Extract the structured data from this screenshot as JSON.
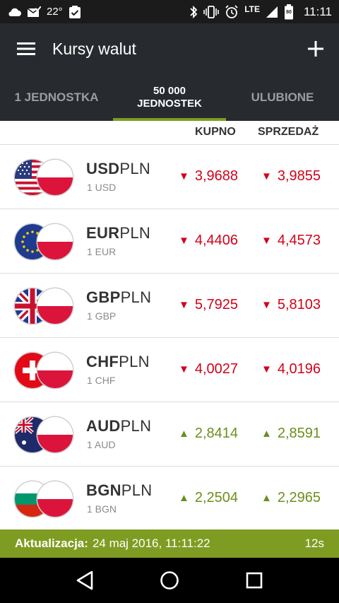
{
  "status_bar": {
    "temperature": "22°",
    "network": "LTE",
    "battery": "80",
    "time": "11:11",
    "icons": [
      "cloud-icon",
      "mail-check-icon",
      "clipboard-check-icon",
      "bluetooth-icon",
      "vibrate-icon",
      "alarm-icon",
      "signal-icon",
      "battery-icon"
    ]
  },
  "app_bar": {
    "title": "Kursy walut",
    "menu_icon": "menu-icon",
    "add_icon": "plus-icon"
  },
  "tabs": [
    {
      "label": "1 JEDNOSTKA",
      "active": false
    },
    {
      "label_line1": "50 000",
      "label_line2": "JEDNOSTEK",
      "active": true
    },
    {
      "label": "ULUBIONE",
      "active": false
    }
  ],
  "columns": {
    "buy": "KUPNO",
    "sell": "SPRZEDAŻ"
  },
  "rates": [
    {
      "base": "USD",
      "quote": "PLN",
      "unit": "1 USD",
      "buy": "3,9688",
      "sell": "3,9855",
      "trend": "down",
      "flag": "us-flag-icon"
    },
    {
      "base": "EUR",
      "quote": "PLN",
      "unit": "1 EUR",
      "buy": "4,4406",
      "sell": "4,4573",
      "trend": "down",
      "flag": "eu-flag-icon"
    },
    {
      "base": "GBP",
      "quote": "PLN",
      "unit": "1 GBP",
      "buy": "5,7925",
      "sell": "5,8103",
      "trend": "down",
      "flag": "gb-flag-icon"
    },
    {
      "base": "CHF",
      "quote": "PLN",
      "unit": "1 CHF",
      "buy": "4,0027",
      "sell": "4,0196",
      "trend": "down",
      "flag": "ch-flag-icon"
    },
    {
      "base": "AUD",
      "quote": "PLN",
      "unit": "1 AUD",
      "buy": "2,8414",
      "sell": "2,8591",
      "trend": "up",
      "flag": "au-flag-icon"
    },
    {
      "base": "BGN",
      "quote": "PLN",
      "unit": "1 BGN",
      "buy": "2,2504",
      "sell": "2,2965",
      "trend": "up",
      "flag": "bg-flag-icon"
    }
  ],
  "update_bar": {
    "label": "Aktualizacja:",
    "datetime": "24 maj 2016, 11:11:22",
    "age": "12s"
  },
  "colors": {
    "accent": "#7f9c22",
    "down": "#d0021b",
    "up": "#6a8f1a",
    "appbar": "#272b2f"
  },
  "arrows": {
    "down": "▼",
    "up": "▲"
  }
}
